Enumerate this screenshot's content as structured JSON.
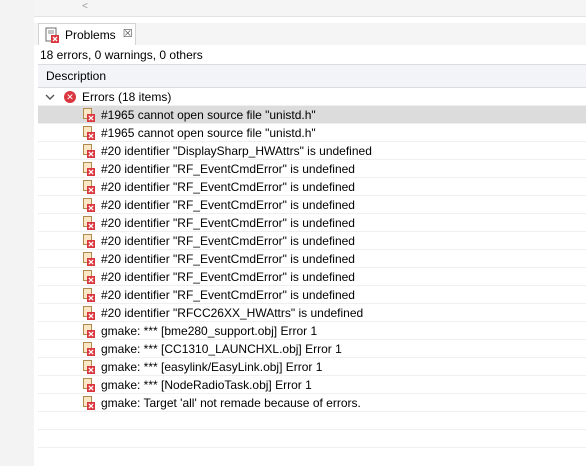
{
  "topbar": {
    "scroll_left_icon": "chevron-left-icon",
    "scroll_left_glyph": "<"
  },
  "tab": {
    "label": "Problems",
    "icon": "problems-view-icon",
    "close_glyph": "☒",
    "close_icon": "close-icon"
  },
  "summary": "18 errors, 0 warnings, 0 others",
  "table": {
    "column_header": "Description"
  },
  "group": {
    "label": "Errors (18 items)",
    "expanded": true,
    "chevron_glyph": "∨",
    "error_glyph": "✕"
  },
  "items": [
    {
      "text": "#1965 cannot open source file \"unistd.h\"",
      "selected": true
    },
    {
      "text": "#1965 cannot open source file \"unistd.h\""
    },
    {
      "text": "#20 identifier \"DisplaySharp_HWAttrs\" is undefined"
    },
    {
      "text": "#20 identifier \"RF_EventCmdError\" is undefined"
    },
    {
      "text": "#20 identifier \"RF_EventCmdError\" is undefined"
    },
    {
      "text": "#20 identifier \"RF_EventCmdError\" is undefined"
    },
    {
      "text": "#20 identifier \"RF_EventCmdError\" is undefined"
    },
    {
      "text": "#20 identifier \"RF_EventCmdError\" is undefined"
    },
    {
      "text": "#20 identifier \"RF_EventCmdError\" is undefined"
    },
    {
      "text": "#20 identifier \"RF_EventCmdError\" is undefined"
    },
    {
      "text": "#20 identifier \"RF_EventCmdError\" is undefined"
    },
    {
      "text": "#20 identifier \"RFCC26XX_HWAttrs\" is undefined"
    },
    {
      "text": "gmake: *** [bme280_support.obj] Error 1"
    },
    {
      "text": "gmake: *** [CC1310_LAUNCHXL.obj] Error 1"
    },
    {
      "text": "gmake: *** [easylink/EasyLink.obj] Error 1"
    },
    {
      "text": "gmake: *** [NodeRadioTask.obj] Error 1"
    },
    {
      "text": "gmake: Target 'all' not remade because of errors."
    }
  ],
  "colors": {
    "error_red": "#d9363e",
    "selection": "#dcdcdc",
    "header_bg": "#f2f4f7"
  }
}
